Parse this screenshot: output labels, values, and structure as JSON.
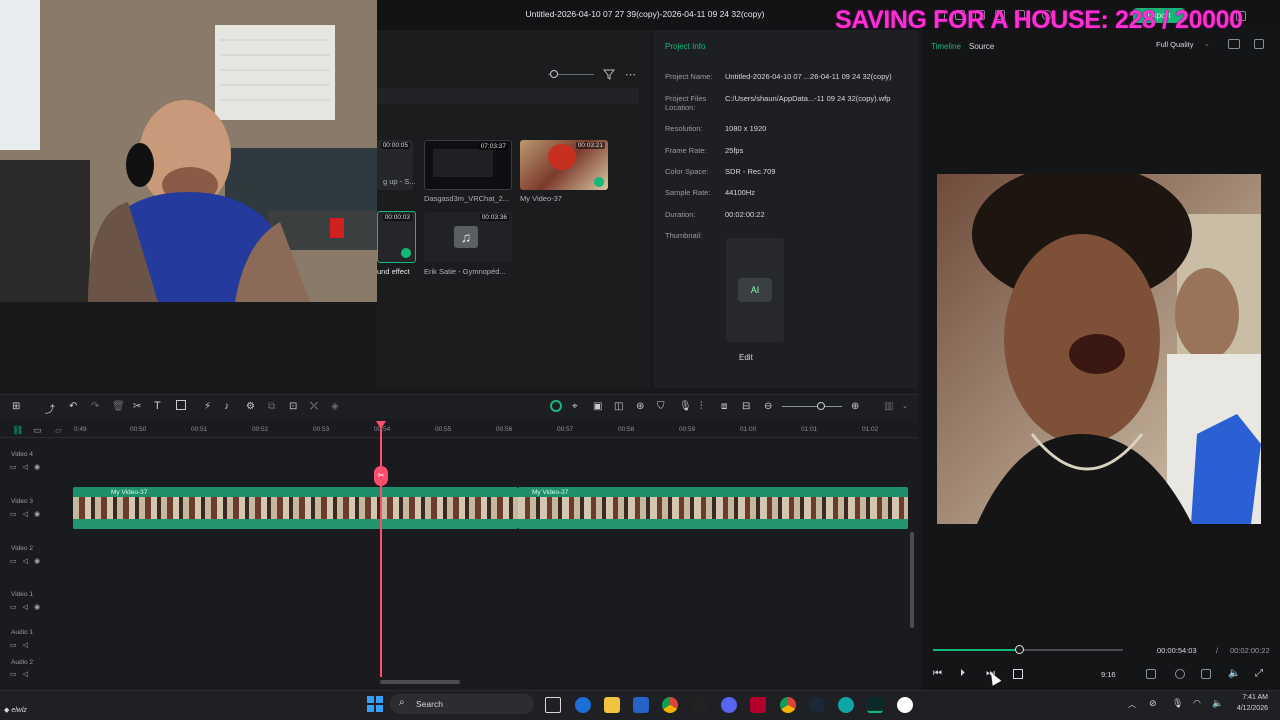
{
  "window": {
    "title": "Untitled-2026-04-10 07 27 39(copy)-2026-04-11 09 24 32(copy)",
    "export_label": "Export"
  },
  "overlay": {
    "banner": "SAVING FOR A HOUSE: 228 / 20000"
  },
  "media": {
    "items": [
      {
        "label": "g up - S...",
        "duration": "00:00:05"
      },
      {
        "label": "Dasgasd3m_VRChat_2...",
        "duration": "07:03:37"
      },
      {
        "label": "My Video-37",
        "duration": "00:03:21"
      },
      {
        "label": "und effect",
        "duration": "00:00:03"
      },
      {
        "label": "Erik Satie - Gymnopéd...",
        "duration": "00:03:36"
      }
    ]
  },
  "project_info": {
    "tab": "Project Info",
    "rows": [
      {
        "key": "Project Name:",
        "value": "Untitled-2026-04-10 07 ...26-04-11 09 24 32(copy)"
      },
      {
        "key": "Project Files Location:",
        "value": "C:/Users/shaun/AppData...-11 09 24 32(copy).wfp"
      },
      {
        "key": "Resolution:",
        "value": "1080 x 1920"
      },
      {
        "key": "Frame Rate:",
        "value": "25fps"
      },
      {
        "key": "Color Space:",
        "value": "SDR - Rec.709"
      },
      {
        "key": "Sample Rate:",
        "value": "44100Hz"
      },
      {
        "key": "Duration:",
        "value": "00:02:00:22"
      },
      {
        "key": "Thumbnail:",
        "value": ""
      }
    ],
    "edit_label": "Edit"
  },
  "preview": {
    "tabs": [
      "Timeline",
      "Source"
    ],
    "quality": "Full Quality",
    "current_time": "00:00:54:03",
    "separator": "/",
    "total_time": "00:02:00:22",
    "aspect": "9:16",
    "progress": 0.45
  },
  "timeline": {
    "ruler": [
      "0:49",
      "00:50",
      "00:51",
      "00:52",
      "00:53",
      "00:54",
      "00:55",
      "00:56",
      "00:57",
      "00:58",
      "00:59",
      "01:00",
      "01:01",
      "01:02"
    ],
    "tracks": [
      "Video 4",
      "Video 3",
      "Video 2",
      "Video 1",
      "Audio 1",
      "Audio 2"
    ],
    "clips": [
      "My Video-37",
      "My Video-37"
    ]
  },
  "taskbar": {
    "search_placeholder": "Search",
    "time": "7:41 AM",
    "date": "4/12/2026"
  },
  "colors": {
    "accent": "#14b879",
    "playhead": "#ff4d6d",
    "banner": "#ff2fd1",
    "clip": "#1f8f6b"
  }
}
